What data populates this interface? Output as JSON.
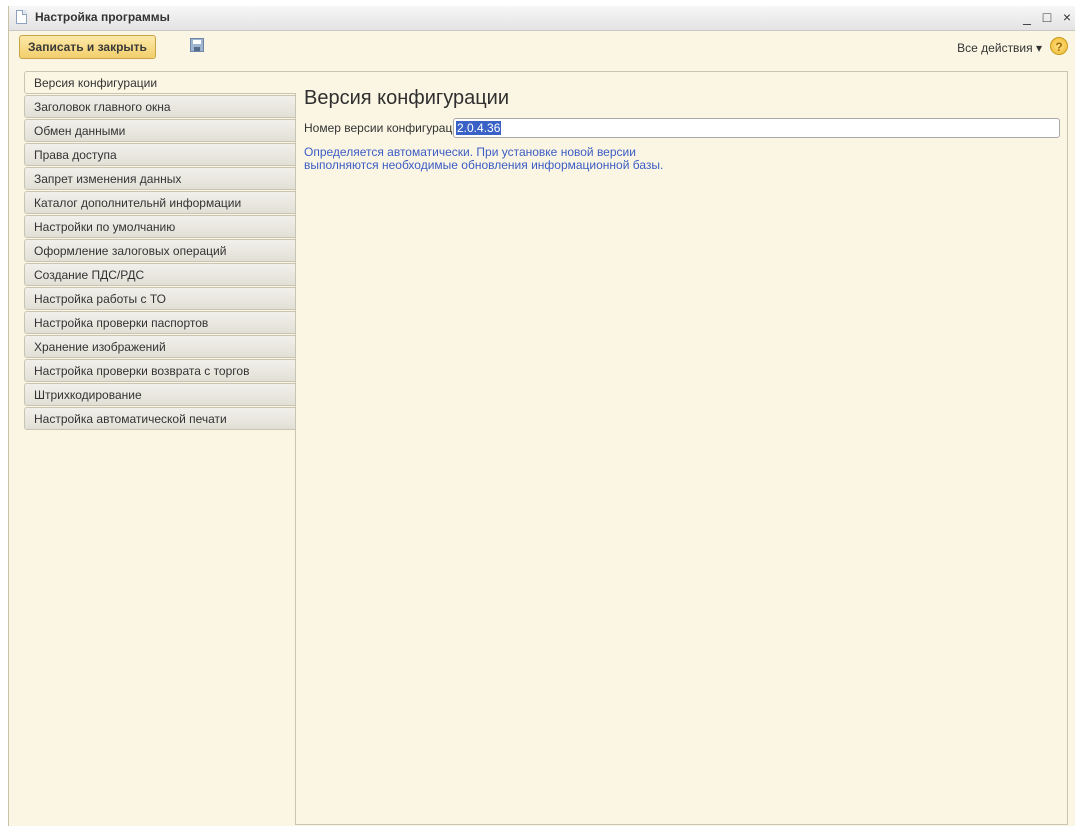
{
  "window": {
    "title": "Настройка программы",
    "minimize_glyph": "_",
    "maximize_glyph": "□",
    "close_glyph": "×"
  },
  "toolbar": {
    "save_close_label": "Записать и закрыть",
    "all_actions_label": "Все действия ▾",
    "help_glyph": "?"
  },
  "nav": {
    "items": [
      {
        "label": "Версия конфигурации",
        "active": true
      },
      {
        "label": "Заголовок главного окна"
      },
      {
        "label": "Обмен данными"
      },
      {
        "label": "Права доступа"
      },
      {
        "label": "Запрет изменения данных"
      },
      {
        "label": "Каталог дополнительнй информации"
      },
      {
        "label": "Настройки по умолчанию"
      },
      {
        "label": "Оформление залоговых операций"
      },
      {
        "label": "Создание ПДС/РДС"
      },
      {
        "label": "Настройка работы с ТО"
      },
      {
        "label": "Настройка проверки паспортов"
      },
      {
        "label": "Хранение изображений"
      },
      {
        "label": "Настройка проверки возврата с торгов"
      },
      {
        "label": "Штрихкодирование"
      },
      {
        "label": "Настройка автоматической печати"
      }
    ]
  },
  "content": {
    "title": "Версия конфигурации",
    "version_label": "Номер версии конфигурации:",
    "version_value": "2.0.4.36",
    "hint_line1": "Определяется автоматически. При установке новой версии",
    "hint_line2": "выполняются необходимые обновления информационной базы."
  },
  "icons": {
    "title_icon": "document-icon",
    "save_icon": "floppy-disk-icon",
    "help_icon": "help-icon"
  },
  "colors": {
    "window_bg": "#fbf6e4",
    "primary_button": "#f3cf6c",
    "hint_text": "#3b5cc5",
    "selection": "#3a62c6"
  }
}
